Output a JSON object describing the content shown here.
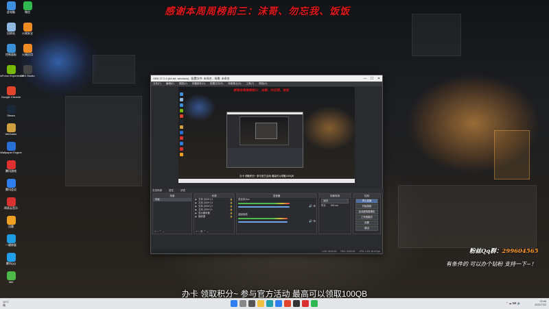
{
  "desktop": {
    "banner": "感谢本周周榜前三：沫哥、勿忘我、饭饭",
    "fan_qq_label": "粉丝Qq群：",
    "fan_qq_number": "299604565",
    "fan_note": "有条件的 可以办个钻粉 支持一下~！",
    "subtitle": "办卡 领取积分~ 参与官方活动 最高可以领取100QB",
    "icons": [
      {
        "label": "此电脑",
        "color": "#3f8fe0"
      },
      {
        "label": "微信",
        "color": "#2fb84f"
      },
      {
        "label": "回收站",
        "color": "#8fb8e0"
      },
      {
        "label": "火绒安全",
        "color": "#f08a22"
      },
      {
        "label": "控制面板",
        "color": "#3a8fd6"
      },
      {
        "label": "火绒应用",
        "color": "#f08a22"
      },
      {
        "label": "GeForce Experience",
        "color": "#76b900"
      },
      {
        "label": "OBS Studio",
        "color": "#444"
      },
      {
        "label": "Google Chrome",
        "color": "#e0442b"
      },
      {
        "label": "Steam",
        "color": "#1b2838"
      },
      {
        "label": "WeGame",
        "color": "#d0a040"
      },
      {
        "label": "Wallpaper Engine",
        "color": "#2a6fd6"
      },
      {
        "label": "腾讯游戏",
        "color": "#e03030"
      },
      {
        "label": "腾讯会议",
        "color": "#2f7ff0"
      },
      {
        "label": "网易云音乐",
        "color": "#d93030"
      },
      {
        "label": "迅雷",
        "color": "#f0a020"
      },
      {
        "label": "一键修复",
        "color": "#1f9be0"
      },
      {
        "label": "腾讯QQ",
        "color": "#1fa0e8"
      },
      {
        "label": "360",
        "color": "#4cb848"
      }
    ]
  },
  "obs": {
    "title": "OBS 27.2.4 (64-bit, windows) - 配置文件: 未命名 - 场景: 未命名",
    "menu": [
      "文件(F)",
      "编辑(E)",
      "视图(V)",
      "停靠部件(D)",
      "配置文件(P)",
      "场景集合(S)",
      "工具(T)",
      "帮助(H)"
    ],
    "preview_banner": "感谢本周周榜前三：沫哥、勿忘我、饭饭",
    "preview_subtitle": "办卡 领取积分~ 参与官方活动 最高可以领取100QB",
    "source_bar_label": "未选择源",
    "source_bar_props": "属性",
    "source_bar_filters": "滤镜",
    "scenes_header": "场景",
    "scenes": [
      "场景"
    ],
    "sources_header": "来源",
    "sources": [
      "文本 (GDI+) 4",
      "文本 (GDI+) 3",
      "文本 (GDI+) 2",
      "文本 (GDI+) 1",
      "显示器采集",
      "媒体源"
    ],
    "mixer_header": "混音器",
    "mixer_tracks": [
      {
        "name": "麦克风/Aux",
        "level": 0.82
      },
      {
        "name": "桌面音频",
        "level": 0.78
      }
    ],
    "transition_header": "场景转换",
    "transition_type": "淡出",
    "transition_duration_label": "时长",
    "transition_duration": "300 ms",
    "controls_header": "控制",
    "controls": [
      "停止直播",
      "开始录制",
      "启动虚拟摄像机",
      "工作室模式",
      "设置",
      "退出"
    ],
    "status": [
      "LIVE: 00:00:00",
      "REC: 00:00:00",
      "CPU: 1.5%, 60.00 fps"
    ]
  },
  "taskbar": {
    "weather_temp": "19°C",
    "weather_desc": "晴",
    "time": "20:46",
    "date": "2022/7/22",
    "apps": [
      {
        "name": "start",
        "color": "#2f7ff0"
      },
      {
        "name": "search",
        "color": "#888"
      },
      {
        "name": "task-view",
        "color": "#555"
      },
      {
        "name": "explorer",
        "color": "#f0c040"
      },
      {
        "name": "edge",
        "color": "#1fa0a8"
      },
      {
        "name": "store",
        "color": "#2f7ff0"
      },
      {
        "name": "chrome",
        "color": "#e0442b"
      },
      {
        "name": "obs",
        "color": "#333"
      },
      {
        "name": "netease",
        "color": "#d93030"
      },
      {
        "name": "wechat",
        "color": "#2fb84f"
      }
    ]
  }
}
